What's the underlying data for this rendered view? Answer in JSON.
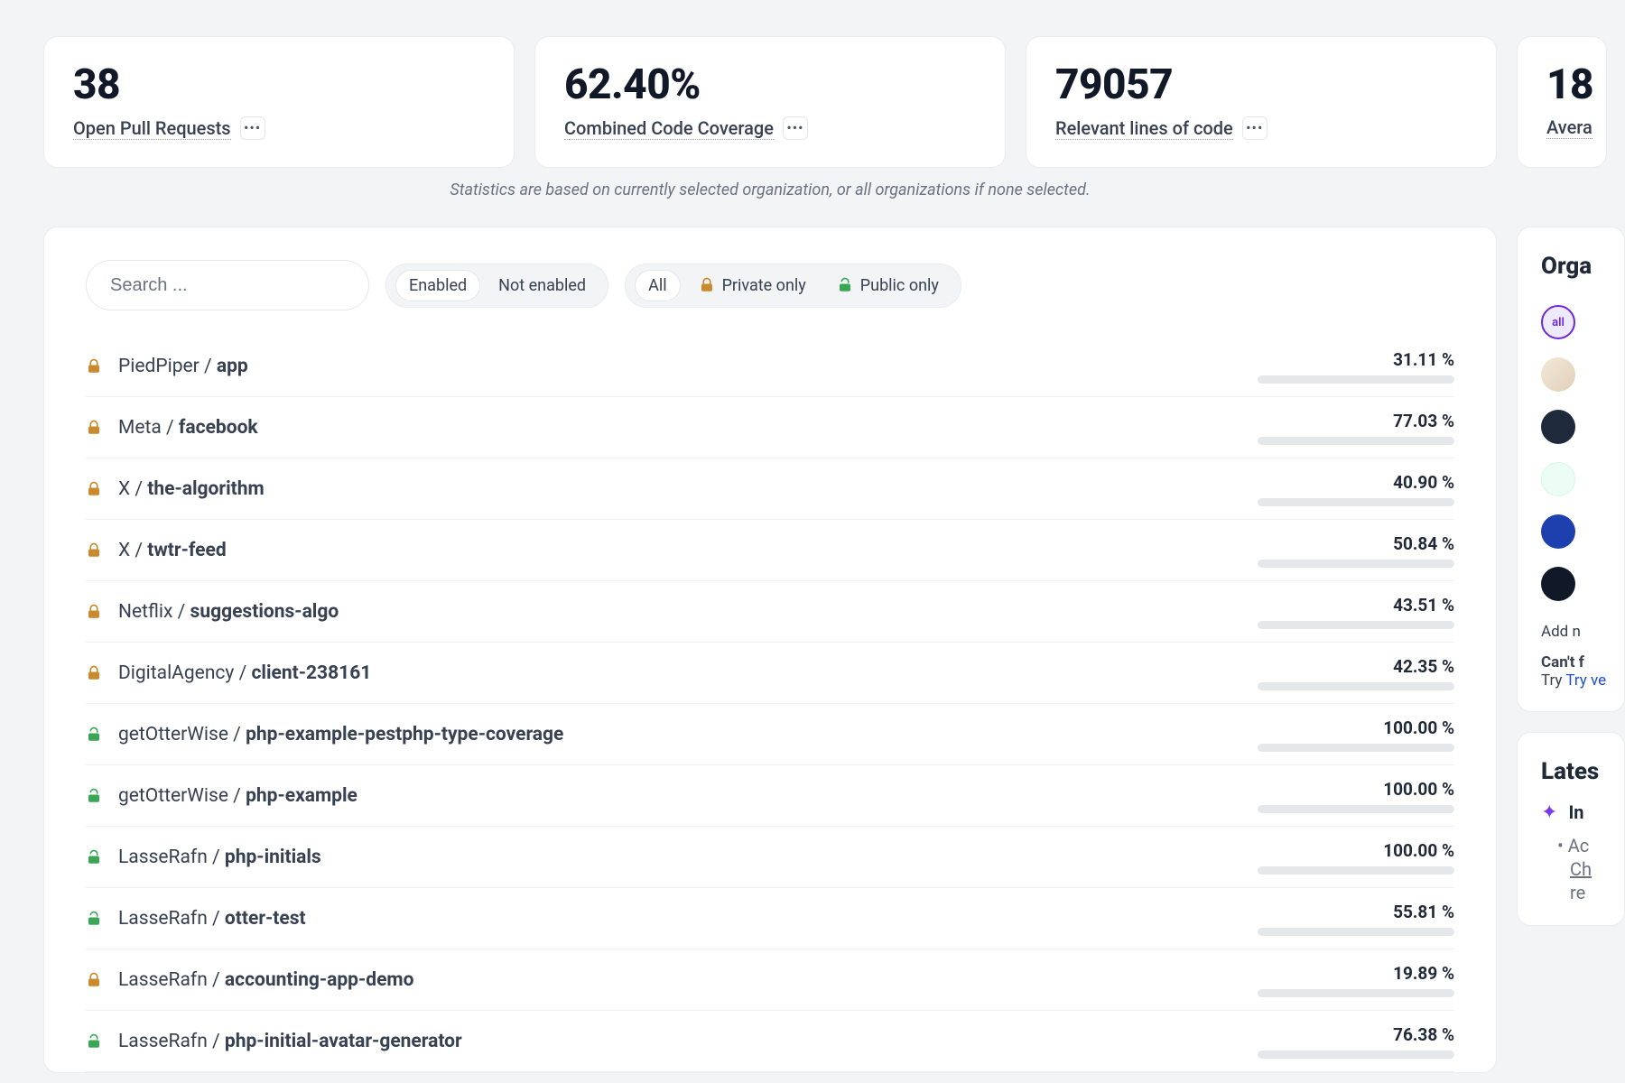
{
  "stats": [
    {
      "value": "38",
      "label": "Open Pull Requests",
      "has_more": true
    },
    {
      "value": "62.40%",
      "label": "Combined Code Coverage",
      "has_more": true
    },
    {
      "value": "79057",
      "label": "Relevant lines of code",
      "has_more": true
    },
    {
      "value": "18",
      "label": "Avera",
      "has_more": false
    }
  ],
  "stats_caption": "Statistics are based on currently selected organization, or all organizations if none selected.",
  "search": {
    "placeholder": "Search ..."
  },
  "filters": {
    "enabled_group": [
      "Enabled",
      "Not enabled"
    ],
    "visibility_group": [
      "All",
      "Private only",
      "Public only"
    ]
  },
  "repos": [
    {
      "priv": true,
      "org": "PiedPiper",
      "name": "app",
      "pct": 31.11,
      "color": "orange"
    },
    {
      "priv": true,
      "org": "Meta",
      "name": "facebook",
      "pct": 77.03,
      "color": "orange"
    },
    {
      "priv": true,
      "org": "X",
      "name": "the-algorithm",
      "pct": 40.9,
      "color": "orange"
    },
    {
      "priv": true,
      "org": "X",
      "name": "twtr-feed",
      "pct": 50.84,
      "color": "orange"
    },
    {
      "priv": true,
      "org": "Netflix",
      "name": "suggestions-algo",
      "pct": 43.51,
      "color": "orange"
    },
    {
      "priv": true,
      "org": "DigitalAgency",
      "name": "client-238161",
      "pct": 42.35,
      "color": "orange"
    },
    {
      "priv": false,
      "org": "getOtterWise",
      "name": "php-example-pestphp-type-coverage",
      "pct": 100.0,
      "color": "green"
    },
    {
      "priv": false,
      "org": "getOtterWise",
      "name": "php-example",
      "pct": 100.0,
      "color": "green"
    },
    {
      "priv": false,
      "org": "LasseRafn",
      "name": "php-initials",
      "pct": 100.0,
      "color": "green"
    },
    {
      "priv": false,
      "org": "LasseRafn",
      "name": "otter-test",
      "pct": 55.81,
      "color": "orange"
    },
    {
      "priv": true,
      "org": "LasseRafn",
      "name": "accounting-app-demo",
      "pct": 19.89,
      "color": "red"
    },
    {
      "priv": false,
      "org": "LasseRafn",
      "name": "php-initial-avatar-generator",
      "pct": 76.38,
      "color": "orange"
    }
  ],
  "sidebar": {
    "orgs_title": "Orga",
    "orgs_all_label": "all",
    "add_text": "Add n",
    "cant_text": "Can't f",
    "try_text": "Try ve",
    "latest_title": "Lates",
    "latest_item": "In",
    "latest_bullet_1": "Ac",
    "latest_bullet_2": "Ch",
    "latest_bullet_3": "re"
  }
}
